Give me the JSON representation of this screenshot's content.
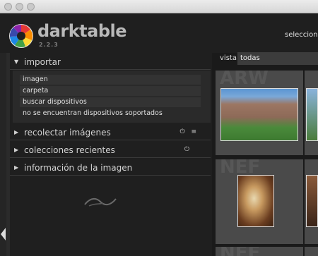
{
  "app": {
    "name": "darktable",
    "version": "2.2.3"
  },
  "header": {
    "view_selector": "seleccionar"
  },
  "modules": {
    "import": {
      "title": "importar",
      "items": [
        "imagen",
        "carpeta",
        "buscar dispositivos",
        "no se encuentran dispositivos soportados"
      ]
    },
    "collect": {
      "title": "recolectar imágenes"
    },
    "recent": {
      "title": "colecciones recientes"
    },
    "info": {
      "title": "información de la imagen"
    }
  },
  "toolbar": {
    "vista_label": "vista",
    "vista_value": "todas"
  },
  "thumbnails": [
    {
      "ext": "ARW"
    },
    {
      "ext": "NEF"
    },
    {
      "ext": "NEF"
    }
  ],
  "colors": {
    "background": "#1c1c1c",
    "panel": "#1f1f1f",
    "thumb_bg": "#4a4a4a"
  }
}
